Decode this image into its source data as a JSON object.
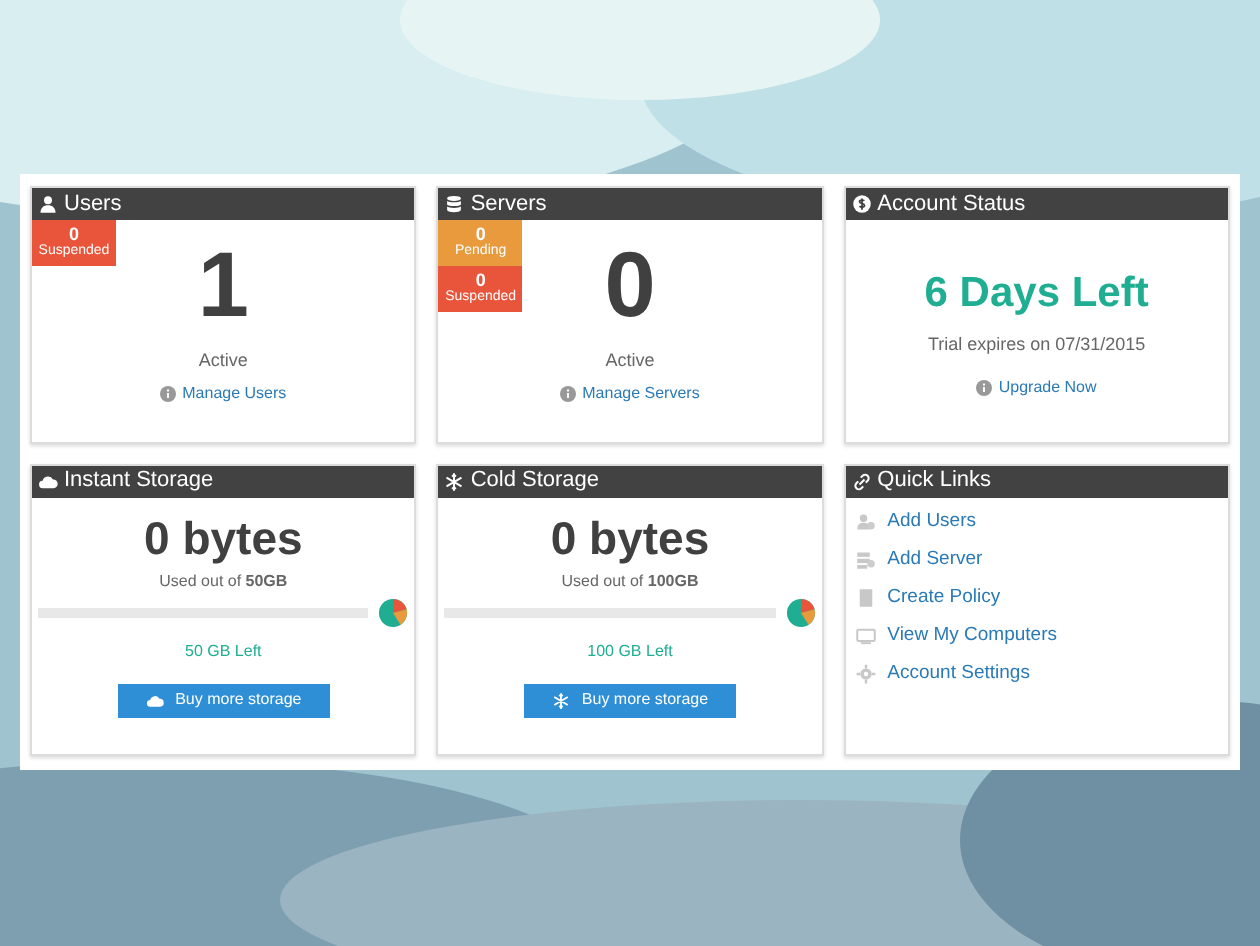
{
  "widgets": [
    {
      "kind": "count",
      "title": "Users",
      "badges": [
        {
          "count": "0",
          "label": "Suspended",
          "color": "#e8553a"
        }
      ],
      "value": "1",
      "caption": "Active",
      "link": "Manage Users"
    },
    {
      "kind": "count",
      "title": "Servers",
      "badges": [
        {
          "count": "0",
          "label": "Pending",
          "color": "#e99a3c"
        },
        {
          "count": "0",
          "label": "Suspended",
          "color": "#e8553a"
        }
      ],
      "value": "0",
      "caption": "Active",
      "link": "Manage Servers"
    },
    {
      "kind": "status",
      "title": "Account Status",
      "headline": "6 Days Left",
      "caption": "Trial expires on 07/31/2015",
      "link": "Upgrade Now"
    },
    {
      "kind": "storage",
      "title": "Instant Storage",
      "value": "0 bytes",
      "used": "Used out of **50GB**",
      "level": 0,
      "left": "50 GB Left",
      "button": "Buy more storage"
    },
    {
      "kind": "storage",
      "title": "Cold Storage",
      "value": "0 bytes",
      "used": "Used out of **100GB**",
      "level": 0,
      "left": "100 GB Left",
      "button": "Buy more storage"
    },
    {
      "kind": "links",
      "title": "Quick Links",
      "links": [
        {
          "label": "Add Users"
        },
        {
          "label": "Add Server"
        },
        {
          "label": "Create Policy"
        },
        {
          "label": "View My Computers"
        },
        {
          "label": "Account Settings"
        }
      ]
    }
  ]
}
